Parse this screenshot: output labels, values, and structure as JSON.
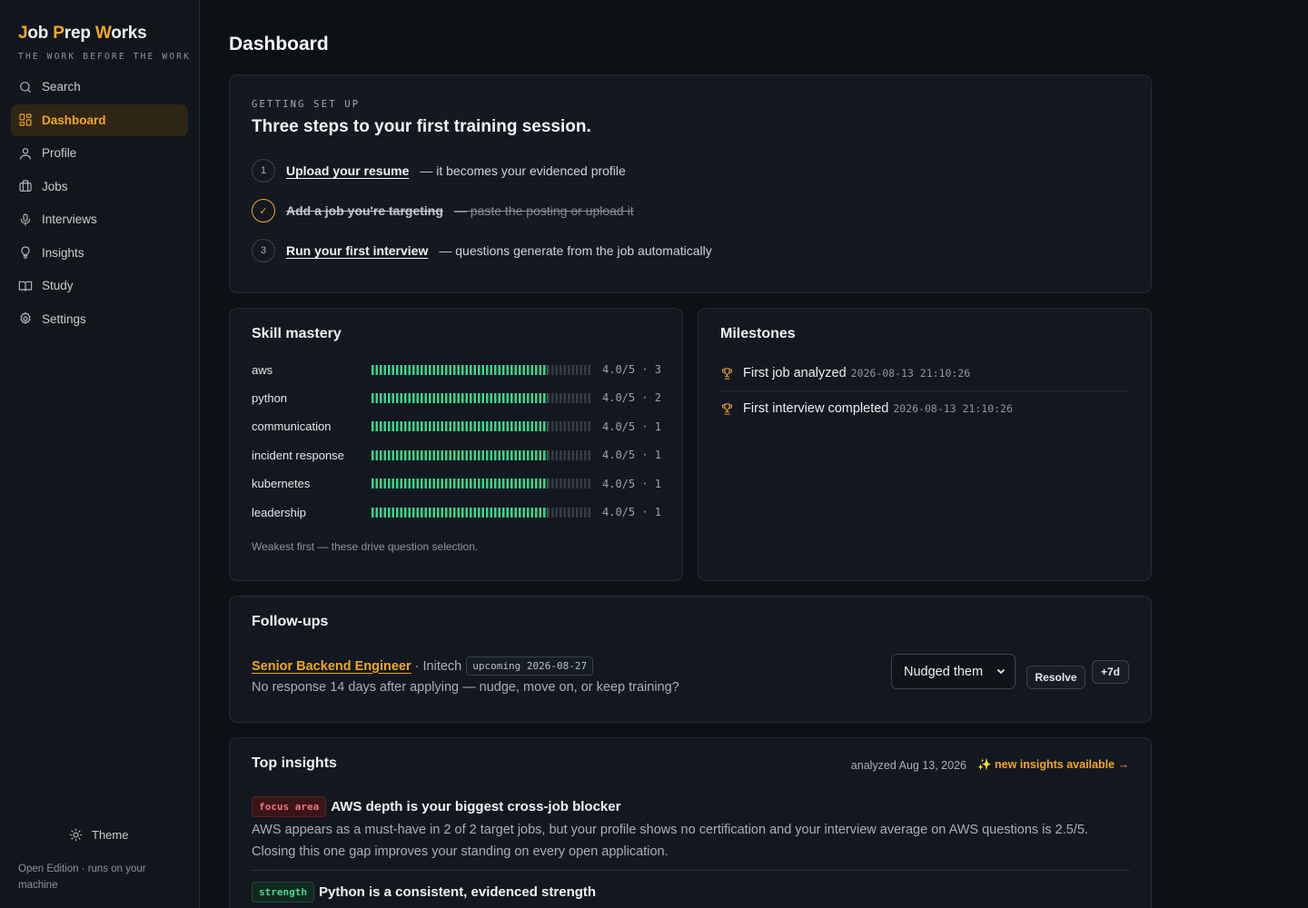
{
  "brand": {
    "part1": "J",
    "part2": "ob ",
    "part3": "P",
    "part4": "rep ",
    "part5": "W",
    "part6": "orks",
    "tagline": "THE WORK BEFORE THE WORK"
  },
  "nav": {
    "items": [
      {
        "label": "Search",
        "icon": "search-icon"
      },
      {
        "label": "Dashboard",
        "icon": "dashboard-icon",
        "active": true
      },
      {
        "label": "Profile",
        "icon": "user-icon"
      },
      {
        "label": "Jobs",
        "icon": "briefcase-icon"
      },
      {
        "label": "Interviews",
        "icon": "microphone-icon"
      },
      {
        "label": "Insights",
        "icon": "lightbulb-icon"
      },
      {
        "label": "Study",
        "icon": "book-icon"
      },
      {
        "label": "Settings",
        "icon": "gear-icon"
      }
    ],
    "theme_label": "Theme",
    "footer": "Open Edition · runs on your machine"
  },
  "page": {
    "title": "Dashboard"
  },
  "setup": {
    "eyebrow": "GETTING SET UP",
    "title": "Three steps to your first training session.",
    "steps": [
      {
        "num": "1",
        "link": "Upload your resume",
        "rest": "— it becomes your evidenced profile",
        "done": false
      },
      {
        "num": "✓",
        "link": "Add a job you're targeting",
        "rest": "— paste the posting or upload it",
        "done": true
      },
      {
        "num": "3",
        "link": "Run your first interview",
        "rest": "— questions generate from the job automatically",
        "done": false
      }
    ]
  },
  "skills": {
    "title": "Skill mastery",
    "max": 5,
    "rows": [
      {
        "name": "aws",
        "score": 4.0,
        "score_text": "4.0/5 · 3"
      },
      {
        "name": "python",
        "score": 4.0,
        "score_text": "4.0/5 · 2"
      },
      {
        "name": "communication",
        "score": 4.0,
        "score_text": "4.0/5 · 1"
      },
      {
        "name": "incident response",
        "score": 4.0,
        "score_text": "4.0/5 · 1"
      },
      {
        "name": "kubernetes",
        "score": 4.0,
        "score_text": "4.0/5 · 1"
      },
      {
        "name": "leadership",
        "score": 4.0,
        "score_text": "4.0/5 · 1"
      }
    ],
    "note": "Weakest first — these drive question selection."
  },
  "milestones": {
    "title": "Milestones",
    "items": [
      {
        "label": "First job analyzed",
        "time": "2026-08-13 21:10:26"
      },
      {
        "label": "First interview completed",
        "time": "2026-08-13 21:10:26"
      }
    ]
  },
  "followups": {
    "title": "Follow-ups",
    "item": {
      "role": "Senior Backend Engineer",
      "company": "· Initech",
      "badge": "upcoming 2026-08-27",
      "desc": "No response 14 days after applying — nudge, move on, or keep training?",
      "select_value": "Nudged them",
      "resolve_label": "Resolve",
      "snooze_label": "+7d"
    }
  },
  "insights": {
    "title": "Top insights",
    "analyzed": "analyzed Aug 13, 2026",
    "new_link": "✨ new insights available →",
    "items": [
      {
        "tag": "focus area",
        "title": "AWS depth is your biggest cross-job blocker",
        "body": "AWS appears as a must-have in 2 of 2 target jobs, but your profile shows no certification and your interview average on AWS questions is 2.5/5. Closing this one gap improves your standing on every open application."
      },
      {
        "tag": "strength",
        "title": "Python is a consistent, evidenced strength"
      }
    ]
  },
  "colors": {
    "accent": "#f5a524",
    "bar_fill": "#3fd38a",
    "background": "#0d1116"
  }
}
